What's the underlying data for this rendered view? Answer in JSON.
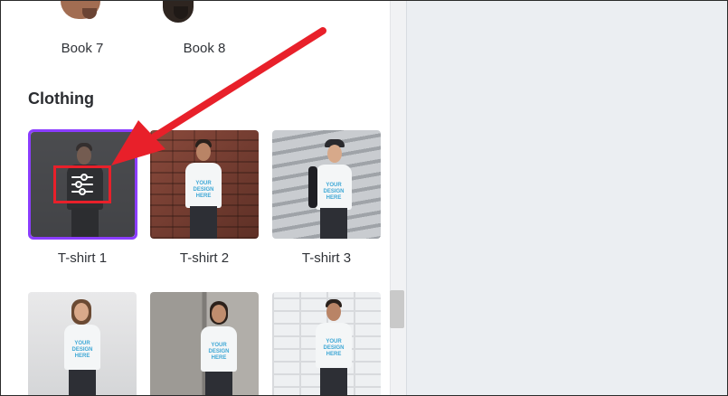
{
  "books": [
    {
      "label": "Book 7"
    },
    {
      "label": "Book 8"
    }
  ],
  "clothing": {
    "title": "Clothing",
    "items": [
      {
        "label": "T-shirt 1",
        "print": ""
      },
      {
        "label": "T-shirt 2",
        "print": "YOUR DESIGN HERE"
      },
      {
        "label": "T-shirt 3",
        "print": "YOUR DESIGN HERE"
      },
      {
        "label": "",
        "print": "YOUR DESIGN HERE"
      },
      {
        "label": "",
        "print": "YOUR DESIGN HERE"
      },
      {
        "label": "",
        "print": "YOUR DESIGN HERE"
      }
    ]
  },
  "annotation": {
    "color": "#e8202a",
    "icon": "sliders-icon"
  },
  "colors": {
    "accent": "#8b3dff",
    "canvas": "#ebeef2"
  }
}
